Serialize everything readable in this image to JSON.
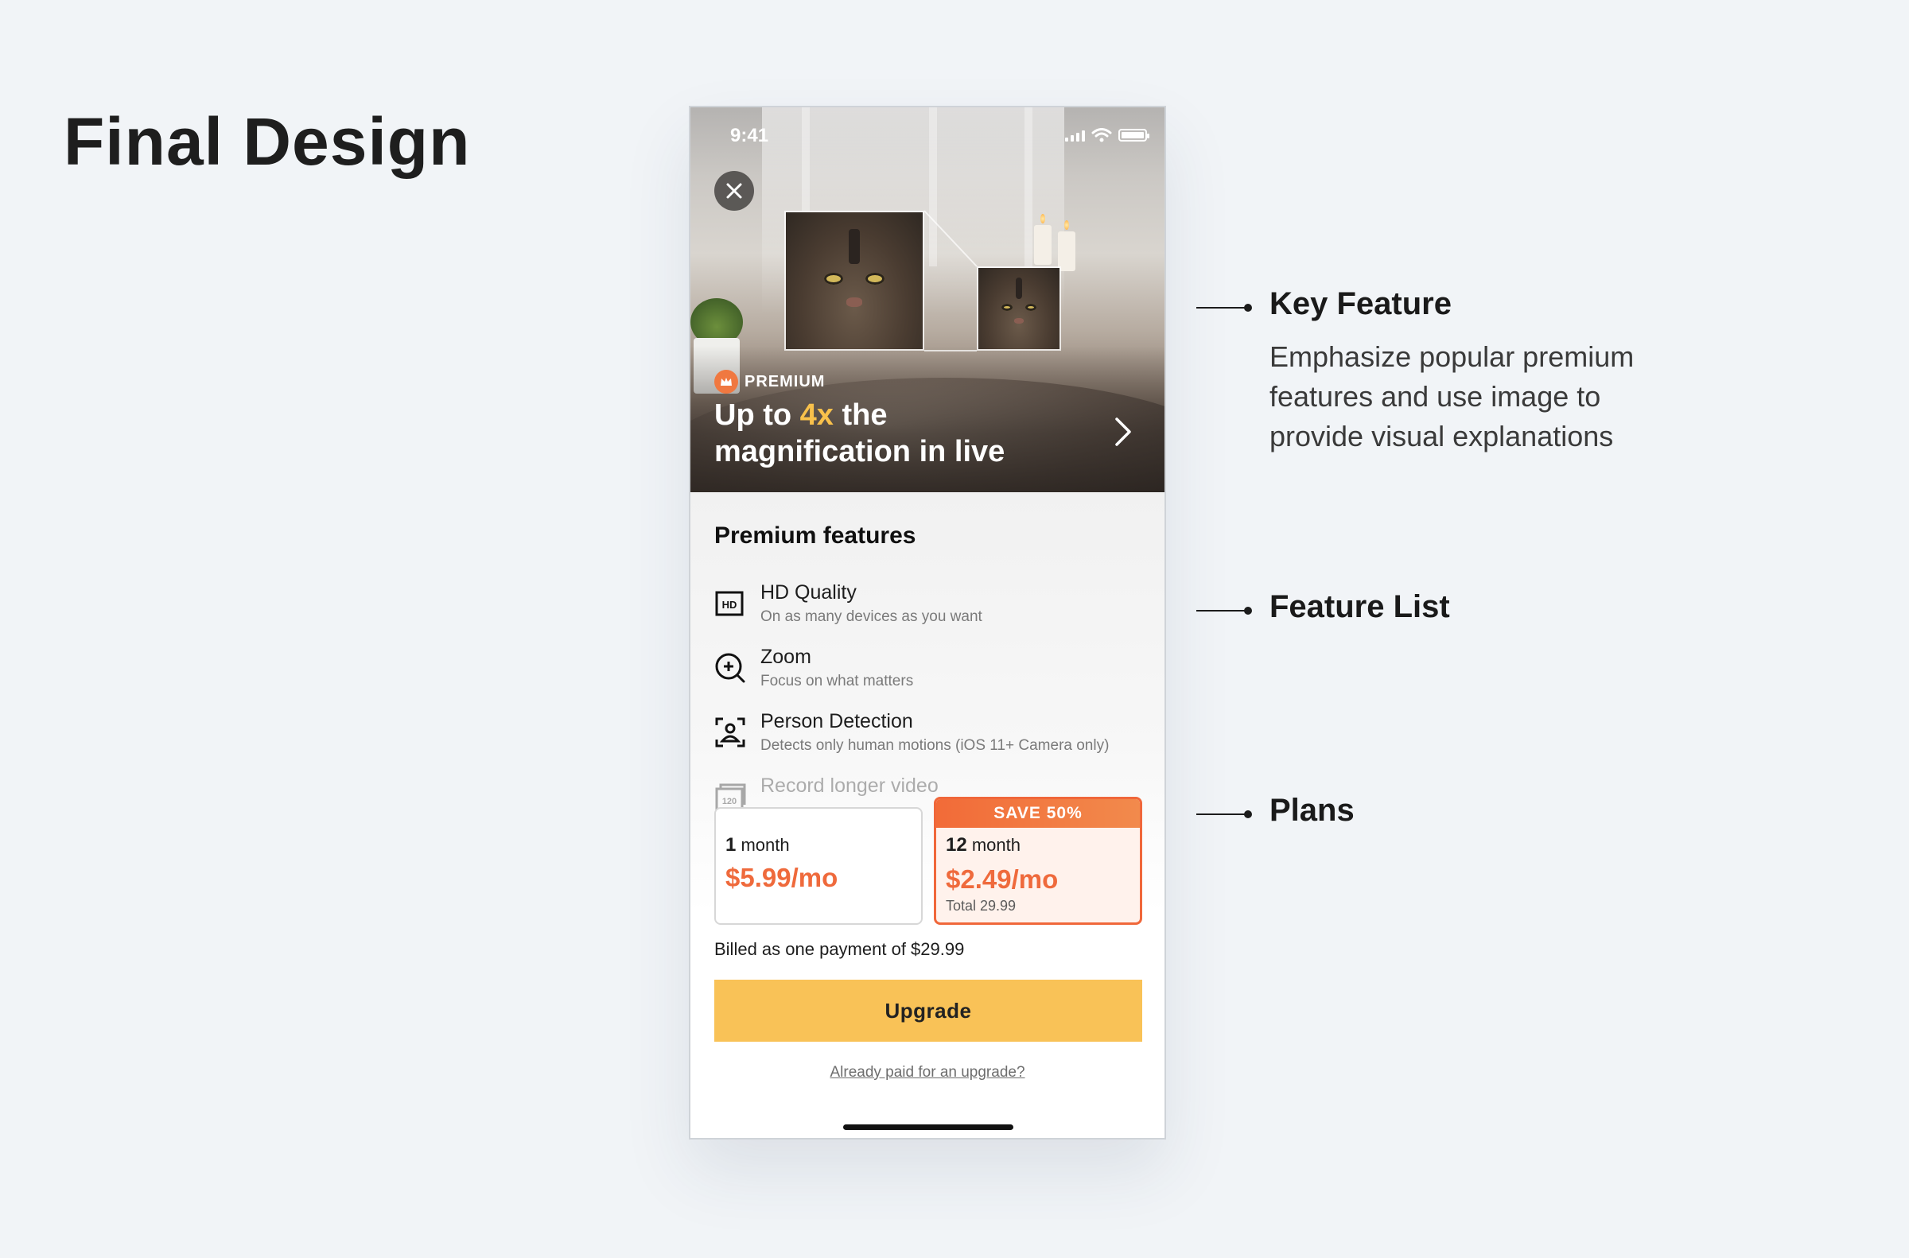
{
  "page": {
    "title": "Final Design"
  },
  "status_bar": {
    "time": "9:41"
  },
  "hero": {
    "badge": "PREMIUM",
    "title_prefix": "Up to ",
    "title_accent": "4x",
    "title_suffix": " the magnification in live",
    "accent_color": "#f9c14b"
  },
  "features": {
    "heading": "Premium features",
    "items": [
      {
        "icon": "hd-icon",
        "title": "HD Quality",
        "subtitle": "On as many devices as you want"
      },
      {
        "icon": "zoom-in-icon",
        "title": "Zoom",
        "subtitle": "Focus on what matters"
      },
      {
        "icon": "person-detection-icon",
        "title": "Person Detection",
        "subtitle": "Detects only human motions (iOS 11+ Camera only)"
      },
      {
        "icon": "record-120-icon",
        "title": "Record longer video",
        "subtitle": ""
      }
    ]
  },
  "plans": {
    "monthly": {
      "duration_number": "1",
      "duration_unit": "month",
      "price": "$5.99/mo"
    },
    "yearly": {
      "ribbon": "SAVE 50%",
      "duration_number": "12",
      "duration_unit": "month",
      "price": "$2.49/mo",
      "total": "Total 29.99"
    },
    "accent_color": "#ef6a3c"
  },
  "billing": {
    "note": "Billed as one payment of $29.99",
    "upgrade_label": "Upgrade",
    "upgrade_color": "#f9c257",
    "already_paid_label": "Already paid for an upgrade?"
  },
  "annotations": {
    "key_feature": {
      "title": "Key Feature",
      "description": "Emphasize popular premium features and use image to provide visual explanations"
    },
    "feature_list": {
      "title": "Feature List"
    },
    "plans": {
      "title": "Plans"
    }
  }
}
